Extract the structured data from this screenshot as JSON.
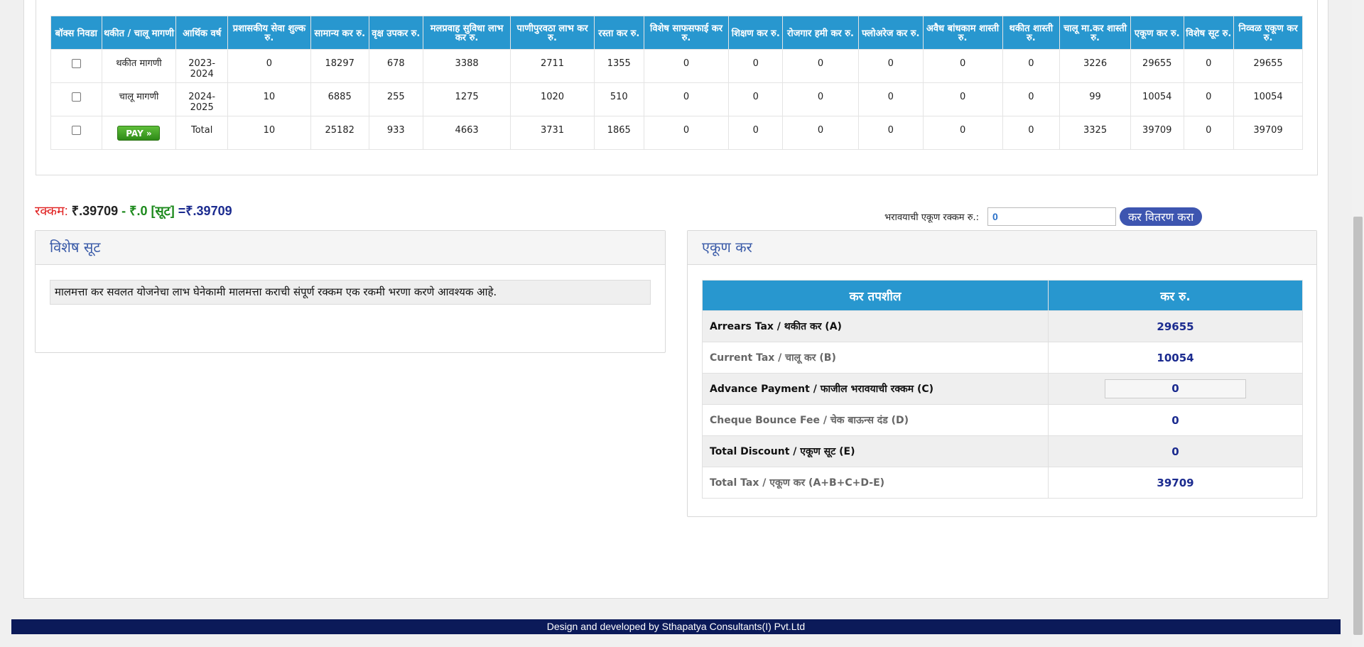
{
  "tax_table": {
    "headers": [
      "बॉक्स निवडा",
      "थकीत / चालू मागणी",
      "आर्थिक वर्ष",
      "प्रशासकीय सेवा शुल्क रु.",
      "सामान्य कर रु.",
      "वृक्ष उपकर रु.",
      "मलप्रवाह सुविधा लाभ कर रु.",
      "पाणीपुरवठा लाभ कर रु.",
      "रस्ता कर रु.",
      "विशेष साफसफाई कर रु.",
      "शिक्षण कर रु.",
      "रोजगार हमी कर रु.",
      "फ्लोअरेज कर रु.",
      "अवैध बांधकाम शास्ती रु.",
      "थकीत शास्ती रु.",
      "चालू मा.कर शास्ती रु.",
      "एकूण कर रु.",
      "विशेष सूट रु.",
      "निव्वळ एकूण कर रु."
    ],
    "rows": [
      [
        "थकीत मागणी",
        "2023-2024",
        "0",
        "18297",
        "678",
        "3388",
        "2711",
        "1355",
        "0",
        "0",
        "0",
        "0",
        "0",
        "0",
        "3226",
        "29655",
        "0",
        "29655"
      ],
      [
        "चालू मागणी",
        "2024-2025",
        "10",
        "6885",
        "255",
        "1275",
        "1020",
        "510",
        "0",
        "0",
        "0",
        "0",
        "0",
        "0",
        "99",
        "10054",
        "0",
        "10054"
      ],
      [
        "",
        "Total",
        "10",
        "25182",
        "933",
        "4663",
        "3731",
        "1865",
        "0",
        "0",
        "0",
        "0",
        "0",
        "0",
        "3325",
        "39709",
        "0",
        "39709"
      ]
    ],
    "pay_button_label": "PAY »"
  },
  "amount_summary": {
    "label": "रक्कम:",
    "total": "₹.39709",
    "minus": "-",
    "discount": "₹.0 [सूट]",
    "net": "=₹.39709"
  },
  "payment_entry": {
    "label": "भरावयाची एकूण रक्कम रु.:",
    "value": "0",
    "distribute_button": "कर वितरण करा"
  },
  "discount_panel": {
    "title": "विशेष सूट",
    "note": "मालमत्ता कर सवलत योजनेचा लाभ घेनेकामी मालमत्ता कराची संपूर्ण रक्कम एक रकमी भरणा करणे आवश्यक आहे."
  },
  "tax_summary": {
    "title": "एकूण कर",
    "col_detail": "कर तपशील",
    "col_amount": "कर रु.",
    "rows": [
      {
        "name": "Arrears Tax / थकीत कर (A)",
        "value": "29655"
      },
      {
        "name": "Current Tax / चालू कर (B)",
        "value": "10054"
      },
      {
        "name": "Advance Payment / फाजील भरावयाची रक्कम (C)",
        "value": "0"
      },
      {
        "name": "Cheque Bounce Fee / चेक बाऊन्स दंड (D)",
        "value": "0"
      },
      {
        "name": "Total Discount / एकूण सूट (E)",
        "value": "0"
      },
      {
        "name": "Total Tax / एकूण कर (A+B+C+D-E)",
        "value": "39709"
      }
    ]
  },
  "footer": {
    "text": "Design and developed by Sthapatya Consultants(I) Pvt.Ltd"
  }
}
